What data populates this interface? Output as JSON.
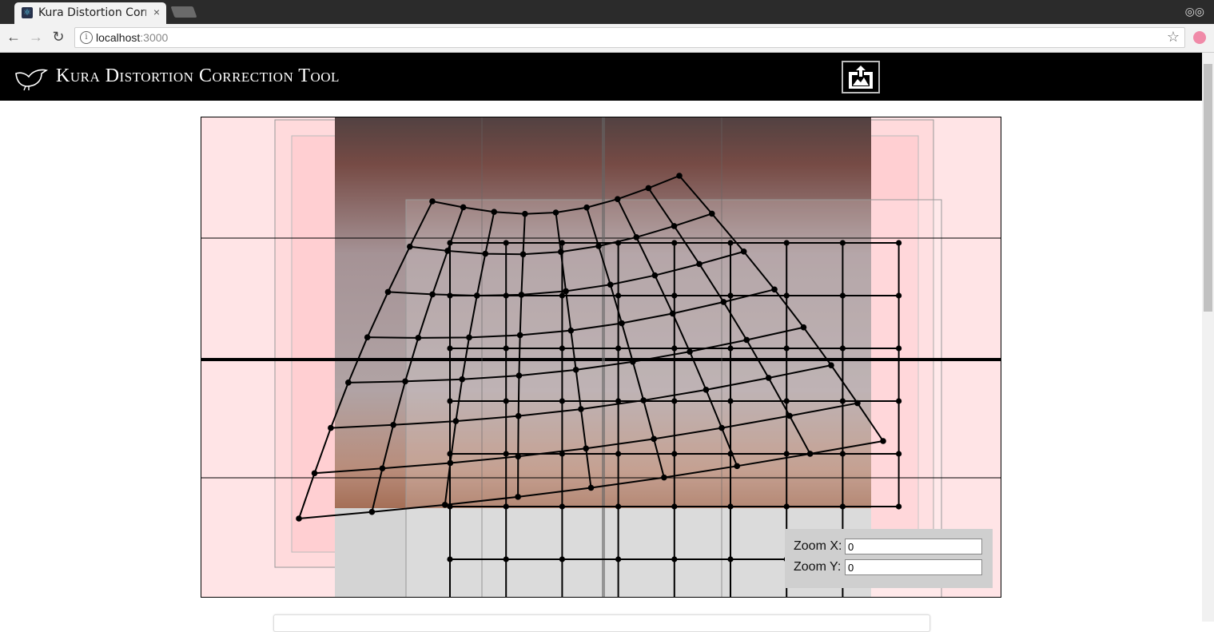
{
  "browser": {
    "tab_title": "Kura Distortion Correction Tool",
    "tab_close": "×",
    "url_host": "localhost",
    "url_port": ":3000"
  },
  "app": {
    "title": "Kura Distortion Correction Tool"
  },
  "zoom": {
    "x_label": "Zoom X:",
    "x_value": "0",
    "y_label": "Zoom Y:",
    "y_value": "0"
  },
  "colors": {
    "canvas_bg": "#ffe4e6",
    "header_bg": "#000000"
  }
}
